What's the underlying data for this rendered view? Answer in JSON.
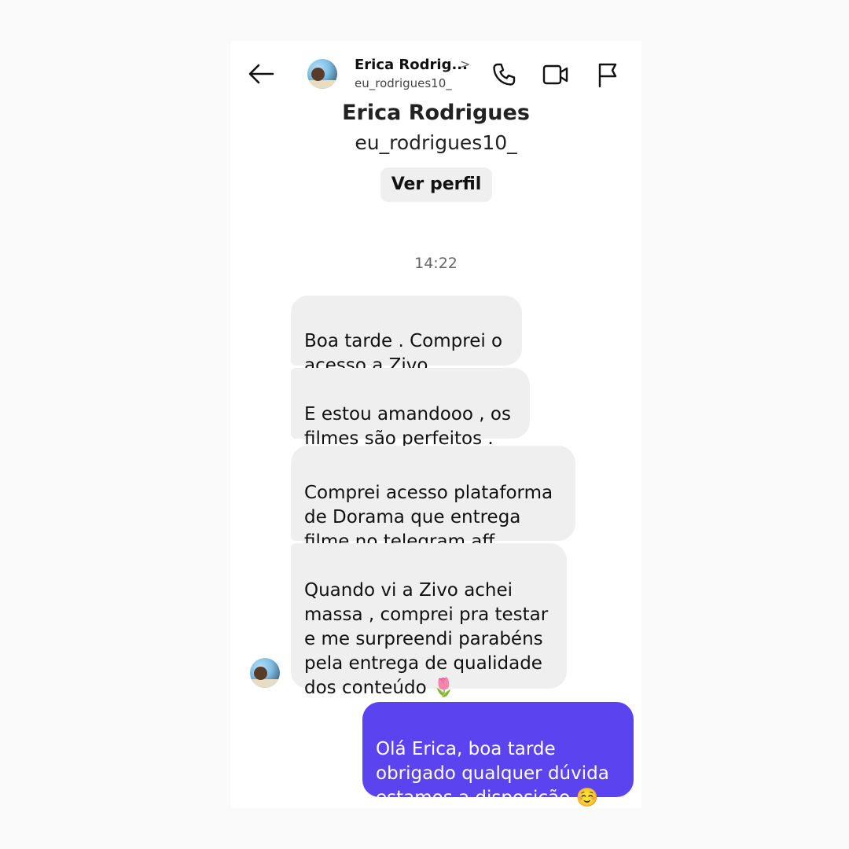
{
  "header": {
    "name": "Erica Rodrig...",
    "username": "eu_rodrigues10_",
    "chevron": ">",
    "icons": [
      "back-arrow-icon",
      "phone-icon",
      "video-icon",
      "flag-icon"
    ]
  },
  "profile": {
    "name": "Erica Rodrigues",
    "username": "eu_rodrigues10_",
    "view_profile_label": "Ver perfil"
  },
  "conversation": {
    "timestamp": "14:22",
    "incoming": [
      "Boa tarde . Comprei o\nacesso a Zivo",
      "E estou amandooo , os\nfilmes são perfeitos .",
      "Comprei acesso plataforma\nde Dorama que entrega\nfilme no telegram aff",
      "Quando vi a Zivo achei\nmassa , comprei pra testar\ne me surpreendi parabéns\npela entrega de qualidade\ndos conteúdo 🌷"
    ],
    "outgoing": [
      "Olá Erica, boa tarde\nobrigado qualquer dúvida\nestamos a disposição ☺️"
    ]
  },
  "colors": {
    "incoming_bubble": "#efefef",
    "outgoing_bubble": "#5b43f0",
    "page_background": "#fafafa"
  }
}
